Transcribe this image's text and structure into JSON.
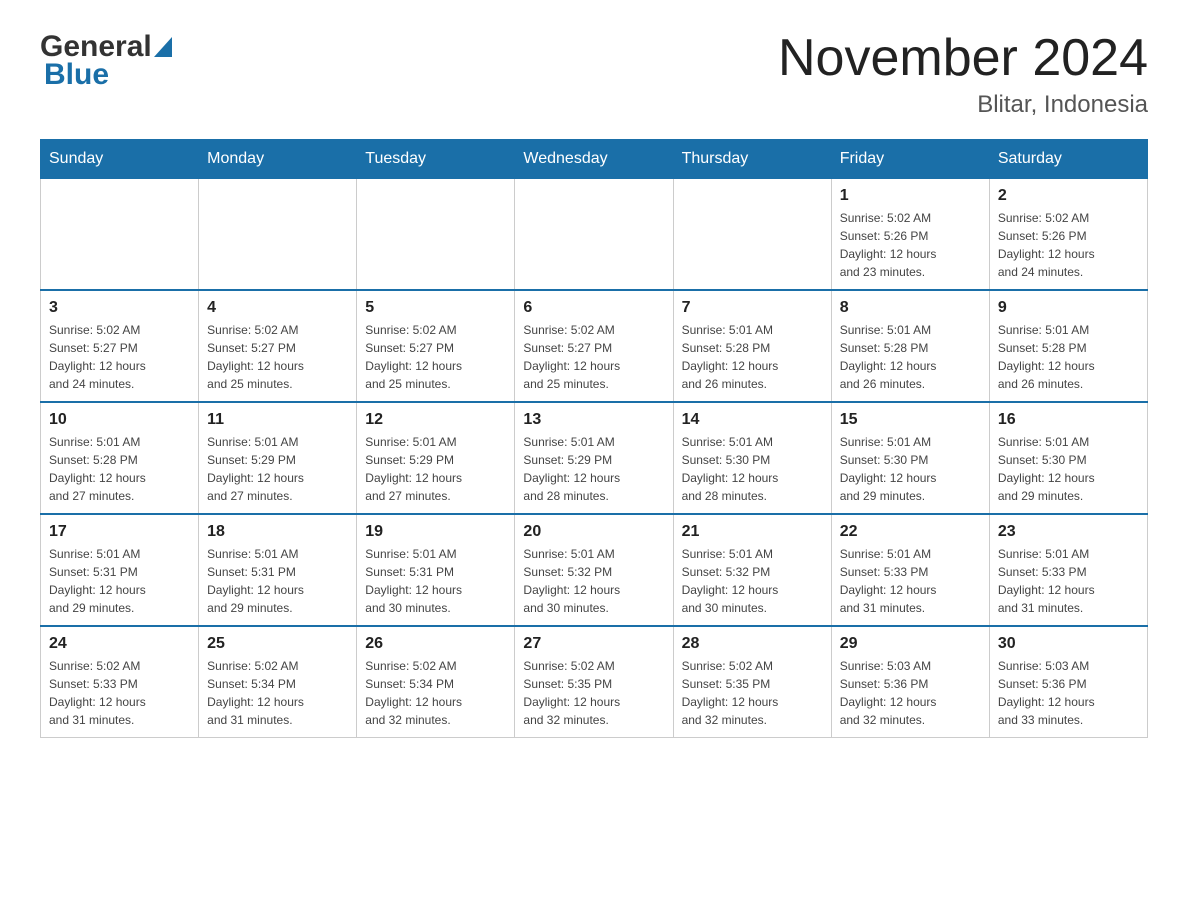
{
  "header": {
    "logo_general": "General",
    "logo_blue": "Blue",
    "title": "November 2024",
    "subtitle": "Blitar, Indonesia"
  },
  "weekdays": [
    "Sunday",
    "Monday",
    "Tuesday",
    "Wednesday",
    "Thursday",
    "Friday",
    "Saturday"
  ],
  "weeks": [
    [
      {
        "day": "",
        "info": ""
      },
      {
        "day": "",
        "info": ""
      },
      {
        "day": "",
        "info": ""
      },
      {
        "day": "",
        "info": ""
      },
      {
        "day": "",
        "info": ""
      },
      {
        "day": "1",
        "info": "Sunrise: 5:02 AM\nSunset: 5:26 PM\nDaylight: 12 hours\nand 23 minutes."
      },
      {
        "day": "2",
        "info": "Sunrise: 5:02 AM\nSunset: 5:26 PM\nDaylight: 12 hours\nand 24 minutes."
      }
    ],
    [
      {
        "day": "3",
        "info": "Sunrise: 5:02 AM\nSunset: 5:27 PM\nDaylight: 12 hours\nand 24 minutes."
      },
      {
        "day": "4",
        "info": "Sunrise: 5:02 AM\nSunset: 5:27 PM\nDaylight: 12 hours\nand 25 minutes."
      },
      {
        "day": "5",
        "info": "Sunrise: 5:02 AM\nSunset: 5:27 PM\nDaylight: 12 hours\nand 25 minutes."
      },
      {
        "day": "6",
        "info": "Sunrise: 5:02 AM\nSunset: 5:27 PM\nDaylight: 12 hours\nand 25 minutes."
      },
      {
        "day": "7",
        "info": "Sunrise: 5:01 AM\nSunset: 5:28 PM\nDaylight: 12 hours\nand 26 minutes."
      },
      {
        "day": "8",
        "info": "Sunrise: 5:01 AM\nSunset: 5:28 PM\nDaylight: 12 hours\nand 26 minutes."
      },
      {
        "day": "9",
        "info": "Sunrise: 5:01 AM\nSunset: 5:28 PM\nDaylight: 12 hours\nand 26 minutes."
      }
    ],
    [
      {
        "day": "10",
        "info": "Sunrise: 5:01 AM\nSunset: 5:28 PM\nDaylight: 12 hours\nand 27 minutes."
      },
      {
        "day": "11",
        "info": "Sunrise: 5:01 AM\nSunset: 5:29 PM\nDaylight: 12 hours\nand 27 minutes."
      },
      {
        "day": "12",
        "info": "Sunrise: 5:01 AM\nSunset: 5:29 PM\nDaylight: 12 hours\nand 27 minutes."
      },
      {
        "day": "13",
        "info": "Sunrise: 5:01 AM\nSunset: 5:29 PM\nDaylight: 12 hours\nand 28 minutes."
      },
      {
        "day": "14",
        "info": "Sunrise: 5:01 AM\nSunset: 5:30 PM\nDaylight: 12 hours\nand 28 minutes."
      },
      {
        "day": "15",
        "info": "Sunrise: 5:01 AM\nSunset: 5:30 PM\nDaylight: 12 hours\nand 29 minutes."
      },
      {
        "day": "16",
        "info": "Sunrise: 5:01 AM\nSunset: 5:30 PM\nDaylight: 12 hours\nand 29 minutes."
      }
    ],
    [
      {
        "day": "17",
        "info": "Sunrise: 5:01 AM\nSunset: 5:31 PM\nDaylight: 12 hours\nand 29 minutes."
      },
      {
        "day": "18",
        "info": "Sunrise: 5:01 AM\nSunset: 5:31 PM\nDaylight: 12 hours\nand 29 minutes."
      },
      {
        "day": "19",
        "info": "Sunrise: 5:01 AM\nSunset: 5:31 PM\nDaylight: 12 hours\nand 30 minutes."
      },
      {
        "day": "20",
        "info": "Sunrise: 5:01 AM\nSunset: 5:32 PM\nDaylight: 12 hours\nand 30 minutes."
      },
      {
        "day": "21",
        "info": "Sunrise: 5:01 AM\nSunset: 5:32 PM\nDaylight: 12 hours\nand 30 minutes."
      },
      {
        "day": "22",
        "info": "Sunrise: 5:01 AM\nSunset: 5:33 PM\nDaylight: 12 hours\nand 31 minutes."
      },
      {
        "day": "23",
        "info": "Sunrise: 5:01 AM\nSunset: 5:33 PM\nDaylight: 12 hours\nand 31 minutes."
      }
    ],
    [
      {
        "day": "24",
        "info": "Sunrise: 5:02 AM\nSunset: 5:33 PM\nDaylight: 12 hours\nand 31 minutes."
      },
      {
        "day": "25",
        "info": "Sunrise: 5:02 AM\nSunset: 5:34 PM\nDaylight: 12 hours\nand 31 minutes."
      },
      {
        "day": "26",
        "info": "Sunrise: 5:02 AM\nSunset: 5:34 PM\nDaylight: 12 hours\nand 32 minutes."
      },
      {
        "day": "27",
        "info": "Sunrise: 5:02 AM\nSunset: 5:35 PM\nDaylight: 12 hours\nand 32 minutes."
      },
      {
        "day": "28",
        "info": "Sunrise: 5:02 AM\nSunset: 5:35 PM\nDaylight: 12 hours\nand 32 minutes."
      },
      {
        "day": "29",
        "info": "Sunrise: 5:03 AM\nSunset: 5:36 PM\nDaylight: 12 hours\nand 32 minutes."
      },
      {
        "day": "30",
        "info": "Sunrise: 5:03 AM\nSunset: 5:36 PM\nDaylight: 12 hours\nand 33 minutes."
      }
    ]
  ]
}
